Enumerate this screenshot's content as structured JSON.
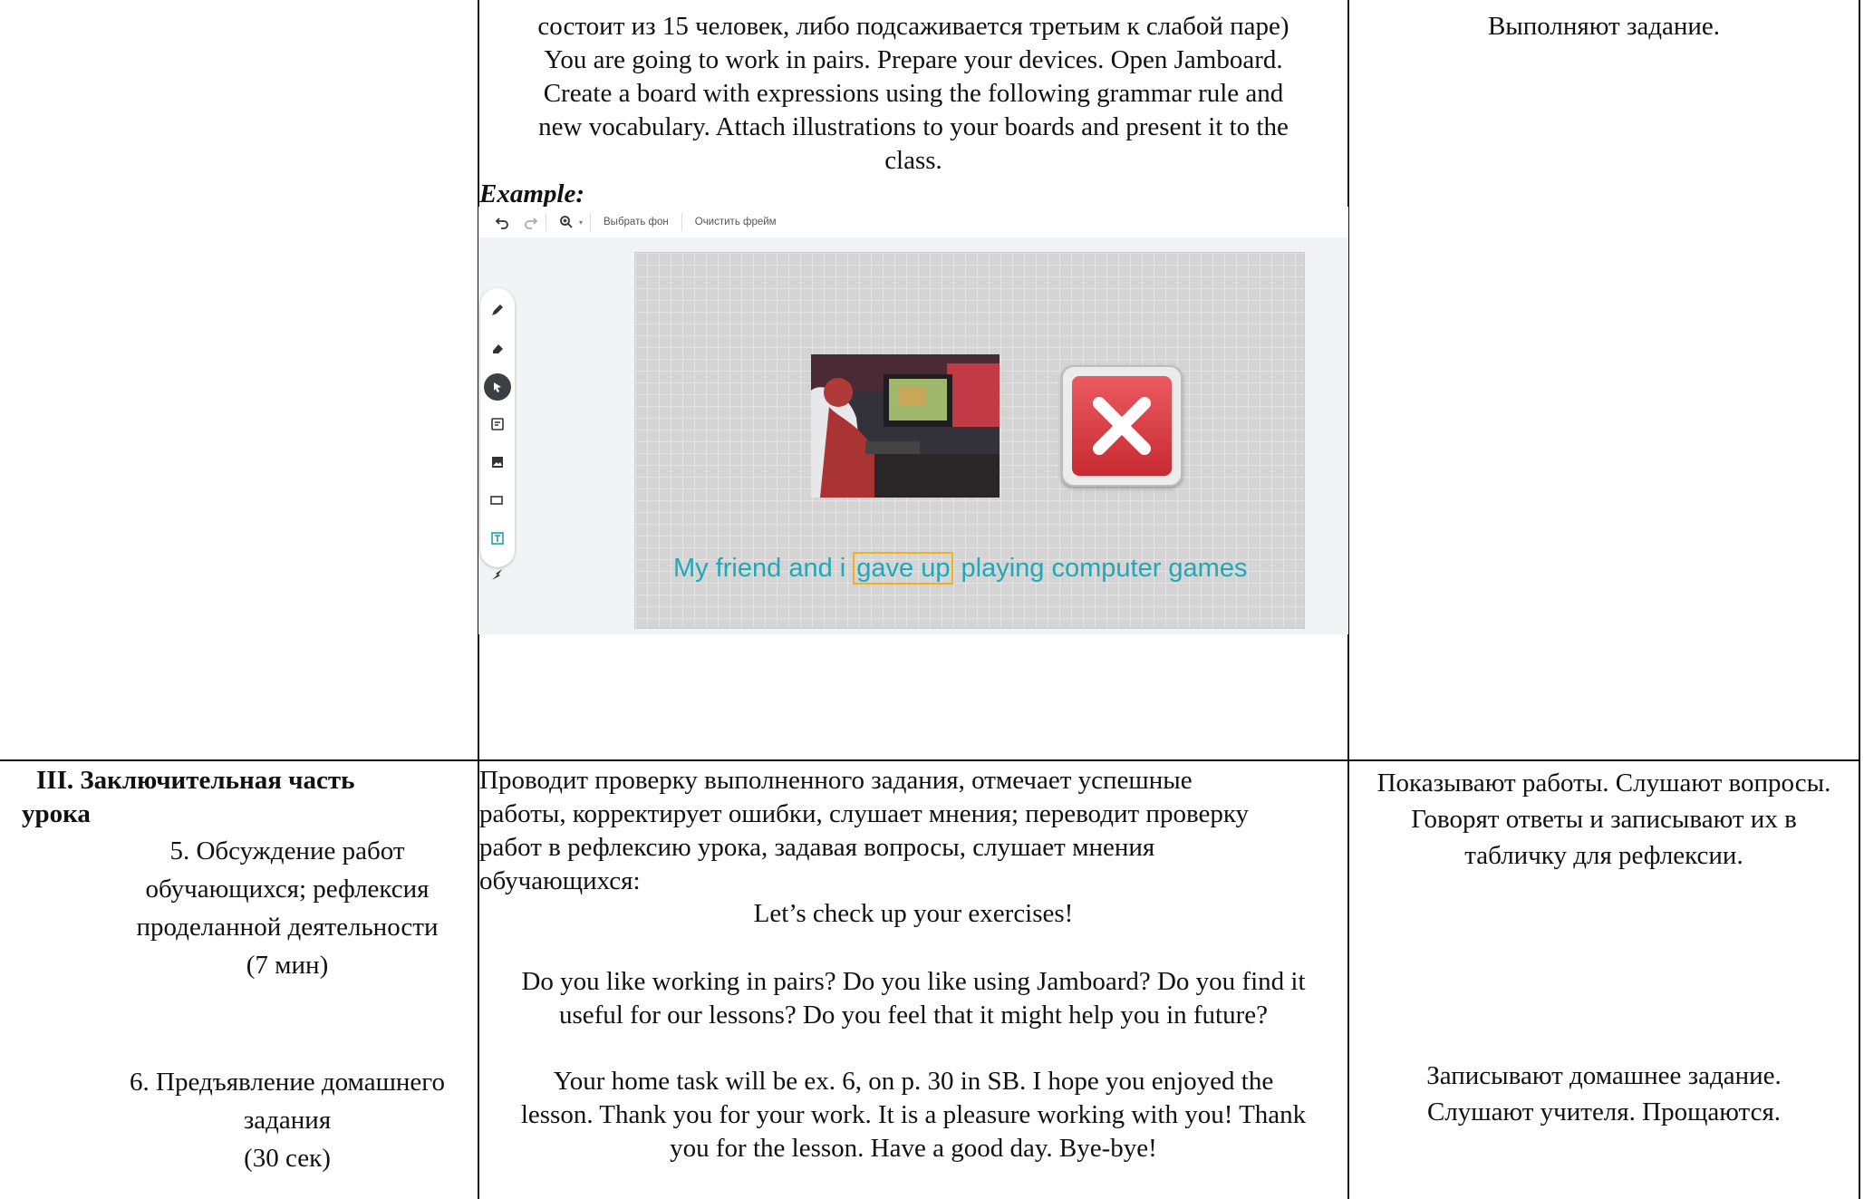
{
  "row1": {
    "mid": {
      "lines": [
        "состоит из 15 человек, либо подсаживается третьим к слабой паре)",
        "You are going to work in pairs. Prepare your devices. Open Jamboard.",
        "Create a board with expressions using the following grammar rule and",
        "new vocabulary. Attach illustrations to your boards and present it to the",
        "class."
      ],
      "example_label": "Example:"
    },
    "right": "Выполняют задание."
  },
  "jamboard": {
    "toolbar": {
      "undo_icon": "undo-icon",
      "redo_icon": "redo-icon",
      "zoom_icon": "zoom-icon",
      "set_background": "Выбрать фон",
      "clear_frame": "Очистить фрейм"
    },
    "tools": [
      "pen-icon",
      "eraser-icon",
      "select-icon",
      "sticky-note-icon",
      "image-icon",
      "shape-icon",
      "text-box-icon",
      "laser-icon"
    ],
    "caption_before": "My friend and i",
    "caption_highlight": "gave up",
    "caption_after": "playing computer games"
  },
  "row2": {
    "left": {
      "heading": "III.  Заключительная часть",
      "heading2": "урока",
      "item5": [
        "5.   Обсуждение работ",
        "обучающихся; рефлексия",
        "проделанной деятельности",
        "(7 мин)"
      ],
      "item6": [
        "6.   Предъявление домашнего",
        "задания",
        "(30 сек)"
      ]
    },
    "mid": {
      "intro": [
        "Проводит проверку выполненного задания, отмечает успешные",
        "работы, корректирует ошибки, слушает мнения; переводит проверку",
        "работ в рефлексию урока, задавая вопросы, слушает мнения",
        "обучающихся:"
      ],
      "check": "Let’s check up your exercises!",
      "questions": [
        "Do you like working in pairs? Do you like using Jamboard? Do you find it",
        "useful for our lessons? Do you feel that it might help you in future?"
      ],
      "homework": [
        "Your home task will be ex. 6, on p. 30 in SB. I hope you enjoyed the",
        "lesson. Thank you for your work. It is a pleasure working with you! Thank",
        "you for the lesson. Have a good day. Bye-bye!"
      ]
    },
    "right": {
      "reflection": [
        "Показывают работы. Слушают вопросы.",
        "Говорят ответы и записывают их в",
        "табличку для рефлексии."
      ],
      "homework": [
        "Записывают домашнее задание.",
        "Слушают учителя. Прощаются."
      ]
    }
  }
}
